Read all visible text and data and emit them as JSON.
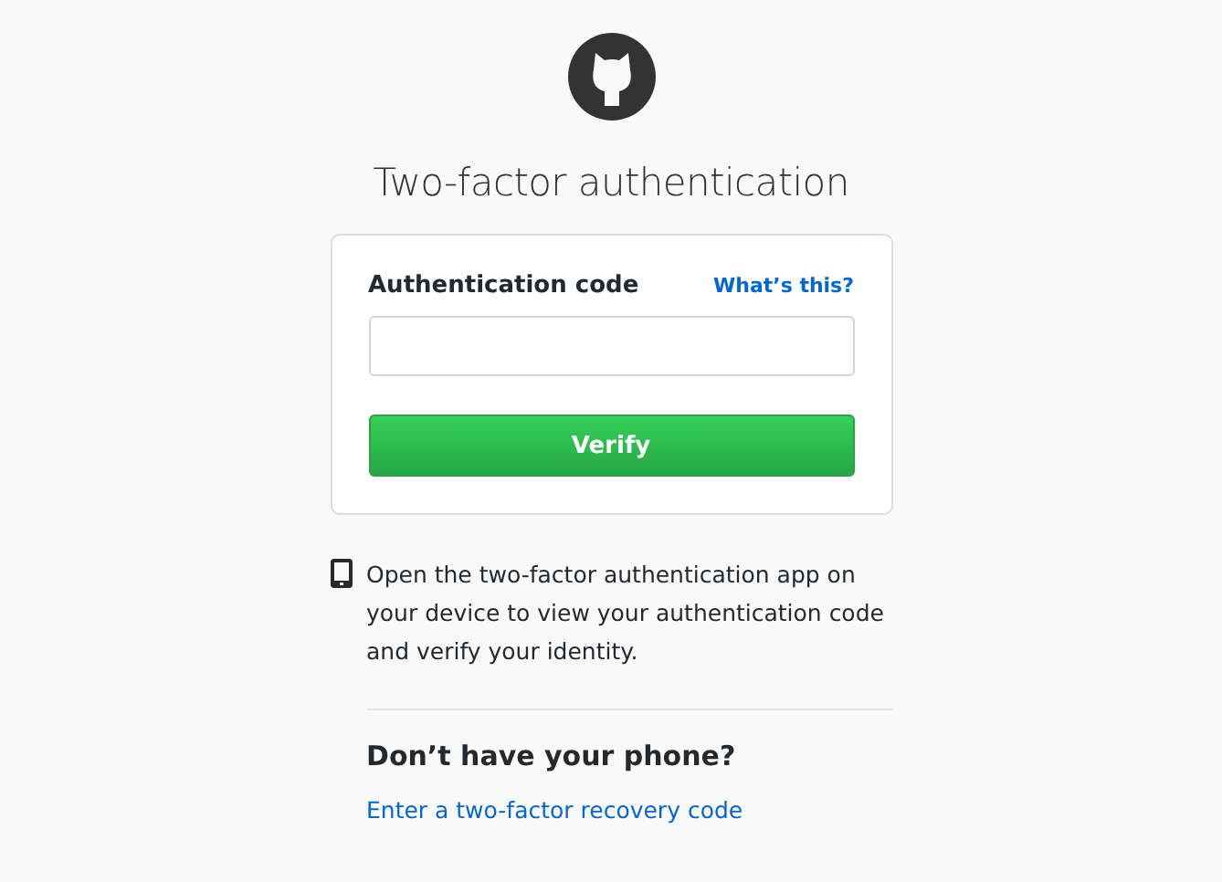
{
  "title": "Two-factor authentication",
  "form": {
    "label": "Authentication code",
    "help_link": "What’s this?",
    "button": "Verify"
  },
  "instructions": "Open the two-factor authentication app on your device to view your authentication code and verify your identity.",
  "recovery": {
    "heading": "Don’t have your phone?",
    "link": "Enter a two-factor recovery code"
  }
}
